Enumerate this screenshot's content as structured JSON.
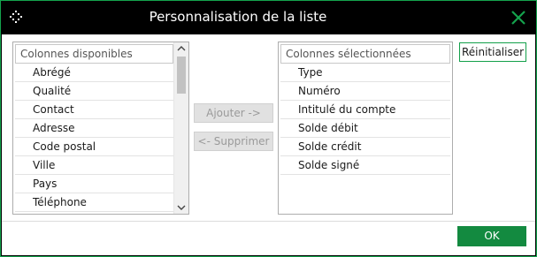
{
  "window": {
    "title": "Personnalisation de la liste",
    "accent_color": "#14a34d"
  },
  "available": {
    "header": "Colonnes disponibles",
    "items": [
      "Abrégé",
      "Qualité",
      "Contact",
      "Adresse",
      "Code postal",
      "Ville",
      "Pays",
      "Téléphone"
    ]
  },
  "selected": {
    "header": "Colonnes sélectionnées",
    "items": [
      "Type",
      "Numéro",
      "Intitulé du compte",
      "Solde débit",
      "Solde crédit",
      "Solde signé"
    ]
  },
  "buttons": {
    "add": "Ajouter ->",
    "remove": "<- Supprimer",
    "reset": "Réinitialiser",
    "ok": "OK"
  },
  "icons": {
    "system": "move-icon",
    "close": "close-icon",
    "scroll_up": "chevron-up-icon",
    "scroll_down": "chevron-down-icon"
  }
}
